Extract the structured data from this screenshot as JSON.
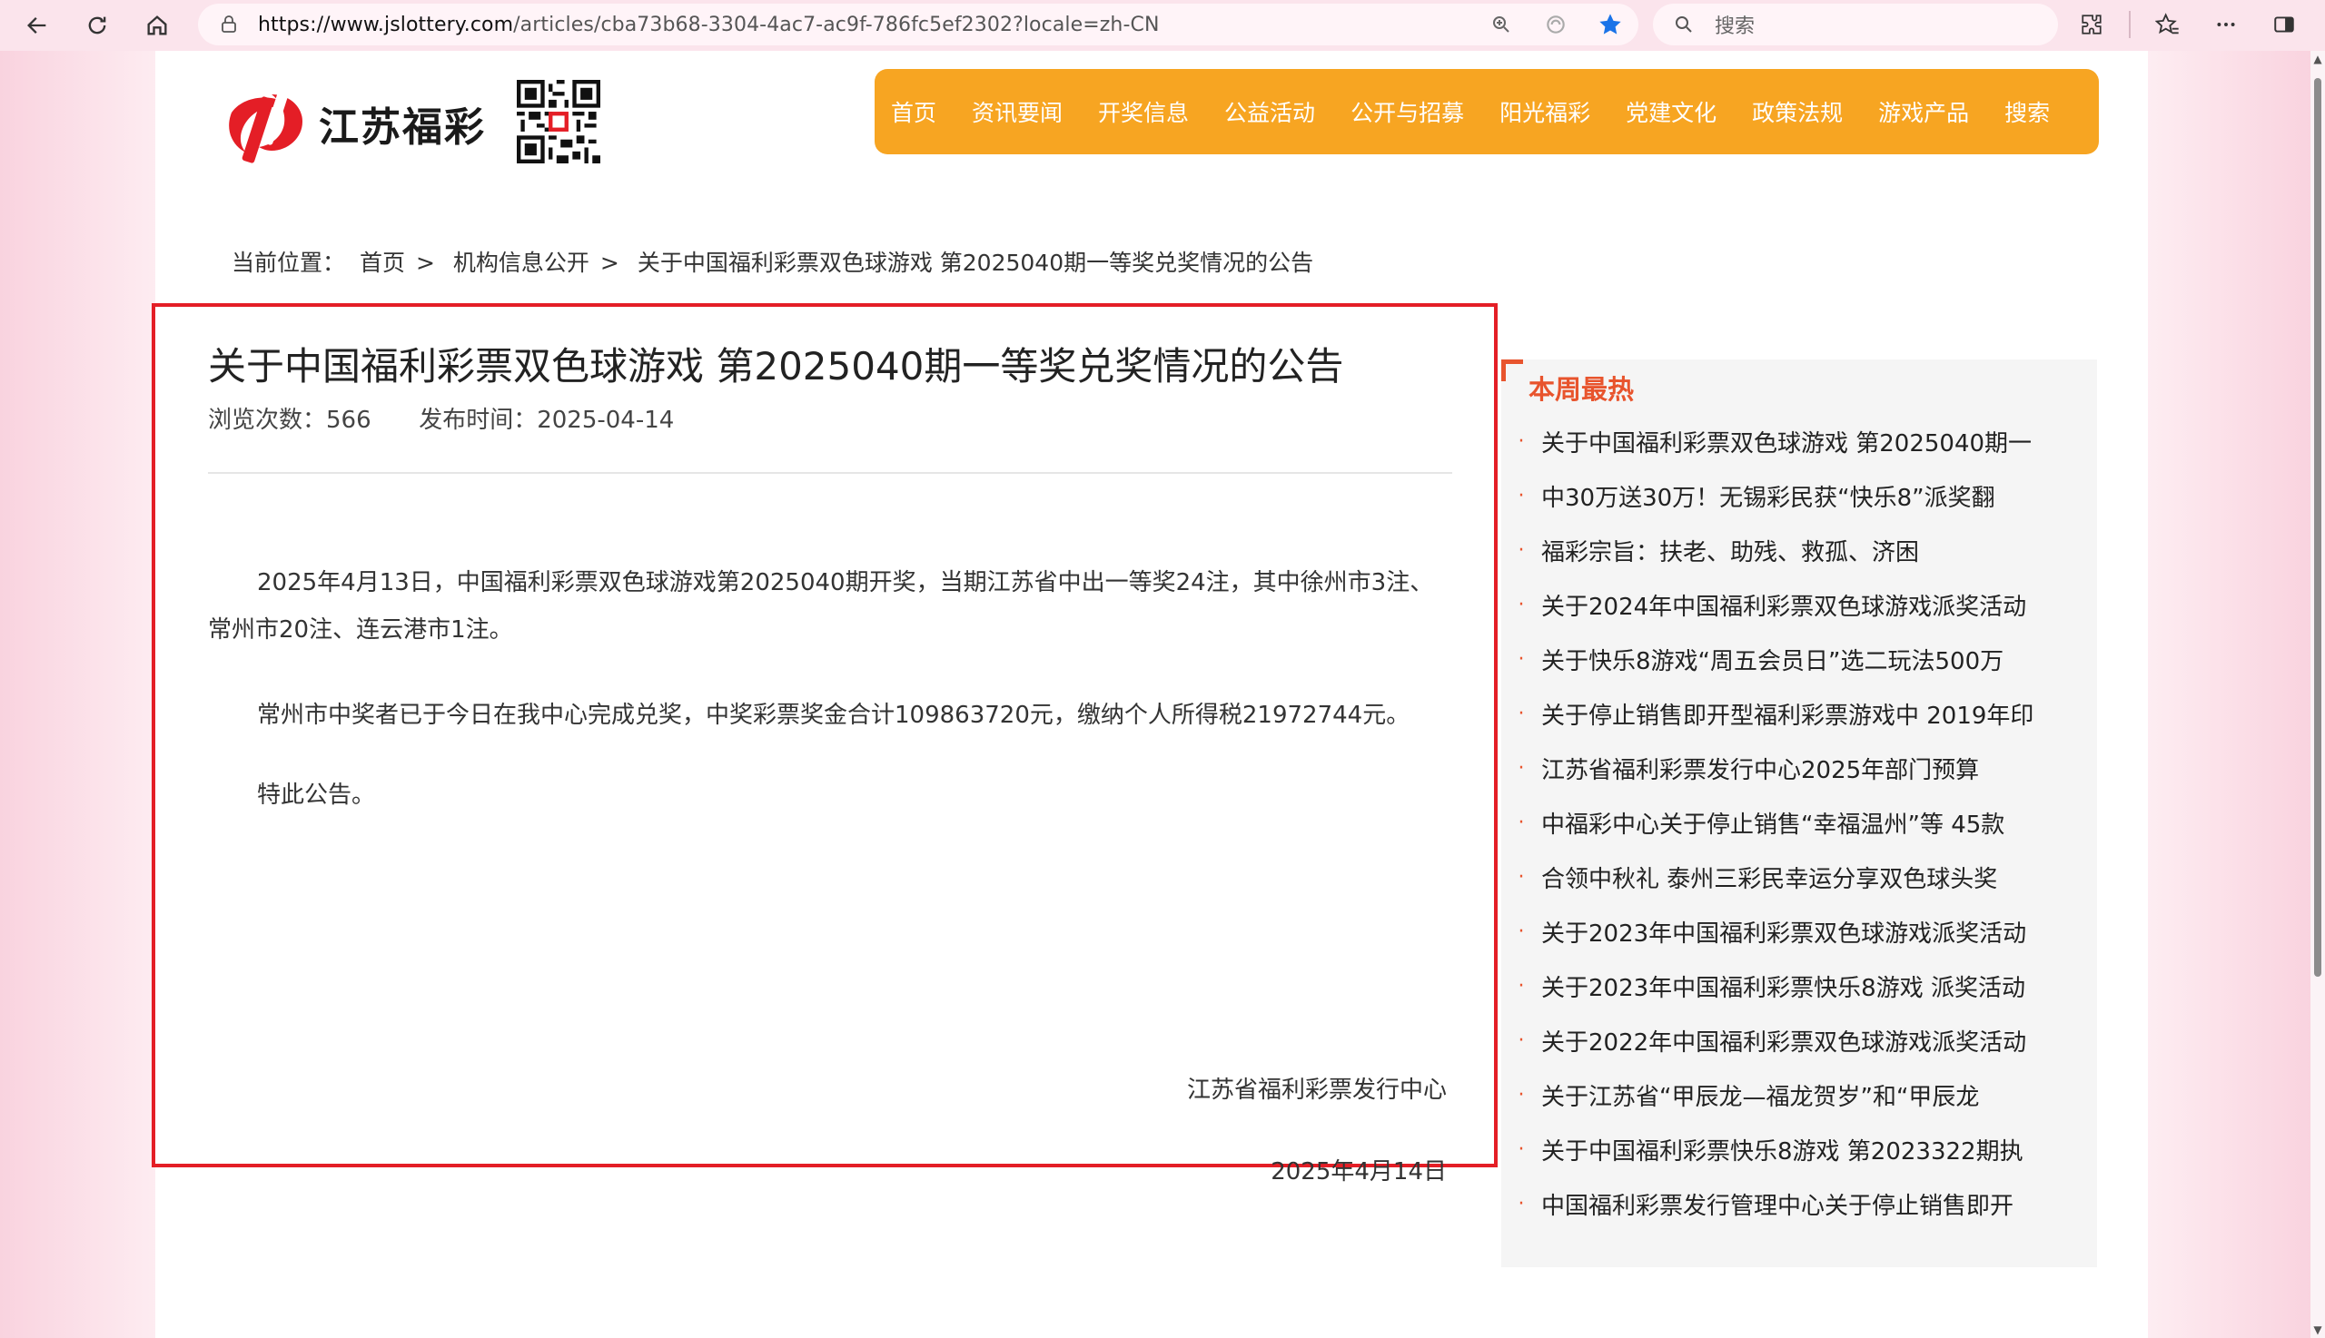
{
  "browser": {
    "url_host": "https://www.jslottery.com",
    "url_rest": "/articles/cba73b68-3304-4ac7-ac9f-786fc5ef2302?locale=zh-CN",
    "search_placeholder": "搜索",
    "bookmark_color": "#1a73e8"
  },
  "site": {
    "logo_text": "江苏福彩",
    "brand_color": "#e41e26",
    "nav_color": "#f7a522",
    "nav": [
      "首页",
      "资讯要闻",
      "开奖信息",
      "公益活动",
      "公开与招募",
      "阳光福彩",
      "党建文化",
      "政策法规",
      "游戏产品",
      "搜索"
    ]
  },
  "breadcrumb": {
    "label": "当前位置：",
    "items": [
      "首页",
      "机构信息公开",
      "关于中国福利彩票双色球游戏 第2025040期一等奖兑奖情况的公告"
    ],
    "separator": ">"
  },
  "article": {
    "title": "关于中国福利彩票双色球游戏 第2025040期一等奖兑奖情况的公告",
    "views_label": "浏览次数：",
    "views": "566",
    "date_label": "发布时间：",
    "date": "2025-04-14",
    "paragraphs": [
      "2025年4月13日，中国福利彩票双色球游戏第2025040期开奖，当期江苏省中出一等奖24注，其中徐州市3注、常州市20注、连云港市1注。",
      "常州市中奖者已于今日在我中心完成兑奖，中奖彩票奖金合计109863720元，缴纳个人所得税21972744元。",
      "特此公告。"
    ],
    "signature": "江苏省福利彩票发行中心",
    "sign_date": "2025年4月14日"
  },
  "sidebar": {
    "title": "本周最热",
    "accent": "#e8542d",
    "items": [
      "关于中国福利彩票双色球游戏 第2025040期一",
      "中30万送30万！无锡彩民获“快乐8”派奖翻",
      "福彩宗旨：扶老、助残、救孤、济困",
      "关于2024年中国福利彩票双色球游戏派奖活动",
      "关于快乐8游戏“周五会员日”选二玩法500万",
      "关于停止销售即开型福利彩票游戏中 2019年印",
      "江苏省福利彩票发行中心2025年部门预算",
      "中福彩中心关于停止销售“幸福温州”等 45款",
      "合领中秋礼 泰州三彩民幸运分享双色球头奖",
      "关于2023年中国福利彩票双色球游戏派奖活动",
      "关于2023年中国福利彩票快乐8游戏 派奖活动",
      "关于2022年中国福利彩票双色球游戏派奖活动",
      "关于江苏省“甲辰龙—福龙贺岁”和“甲辰龙",
      "关于中国福利彩票快乐8游戏 第2023322期执",
      "中国福利彩票发行管理中心关于停止销售即开"
    ]
  }
}
